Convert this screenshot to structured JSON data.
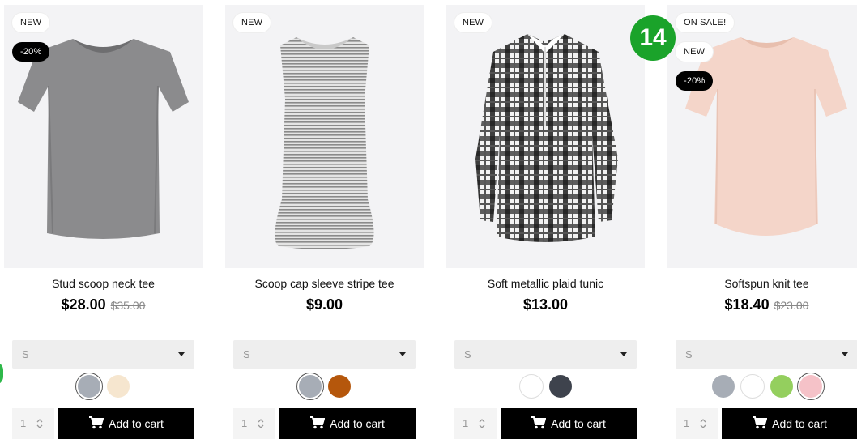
{
  "notification_count": "14",
  "products": [
    {
      "name": "Stud scoop neck tee",
      "price": "$28.00",
      "old_price": "$35.00",
      "badges": [
        "NEW",
        "-20%"
      ],
      "size": "S",
      "swatches": [
        "#a7adb6",
        "#f6e6cf"
      ],
      "qty": "1",
      "add_label": "Add to cart",
      "image": "gray-heather-tee"
    },
    {
      "name": "Scoop cap sleeve stripe tee",
      "price": "$9.00",
      "old_price": "",
      "badges": [
        "NEW"
      ],
      "size": "S",
      "swatches": [
        "#a7adb6",
        "#b5570c"
      ],
      "qty": "1",
      "add_label": "Add to cart",
      "image": "stripe-sleeveless-tee"
    },
    {
      "name": "Soft metallic plaid tunic",
      "price": "$13.00",
      "old_price": "",
      "badges": [
        "NEW"
      ],
      "size": "S",
      "swatches": [
        "#ffffff",
        "#3e434d"
      ],
      "qty": "1",
      "add_label": "Add to cart",
      "image": "plaid-tunic"
    },
    {
      "name": "Softspun knit tee",
      "price": "$18.40",
      "old_price": "$23.00",
      "badges": [
        "ON SALE!",
        "NEW",
        "-20%"
      ],
      "size": "S",
      "swatches": [
        "#a7adb6",
        "#ffffff",
        "#94cf5e",
        "#f5c2c8"
      ],
      "qty": "1",
      "add_label": "Add to cart",
      "image": "pink-knit-tee"
    }
  ]
}
